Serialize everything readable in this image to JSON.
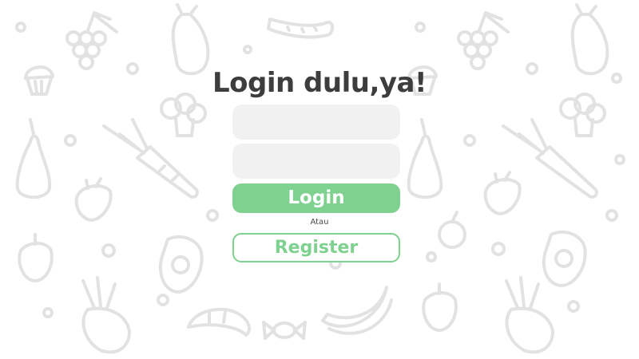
{
  "login": {
    "title": "Login dulu,ya!",
    "username_value": "",
    "password_value": "",
    "login_label": "Login",
    "separator": "Atau",
    "register_label": "Register"
  },
  "colors": {
    "accent": "#7fd18f",
    "title": "#3d3d3d",
    "input_bg": "#f1f1f1",
    "doodle": "#e2e2e2",
    "background": "#ffffff"
  },
  "background_icons": [
    "grapes-icon",
    "eggplant-icon",
    "cucumber-icon",
    "muffin-icon",
    "broccoli-icon",
    "pear-icon",
    "carrot-icon",
    "strawberry-icon",
    "bell-pepper-icon",
    "avocado-icon",
    "beet-icon",
    "croissant-icon",
    "banana-icon",
    "candy-icon",
    "plum-icon"
  ]
}
